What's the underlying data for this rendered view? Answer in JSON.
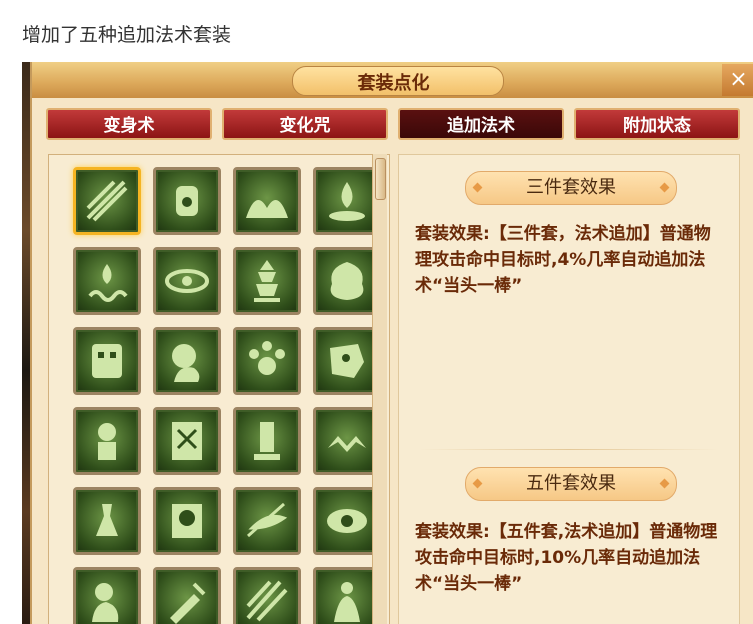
{
  "caption": "增加了五种追加法术套装",
  "window": {
    "title": "套装点化",
    "close_glyph": "×"
  },
  "tabs": [
    {
      "label": "变身术",
      "active": false
    },
    {
      "label": "变化咒",
      "active": false
    },
    {
      "label": "追加法术",
      "active": true
    },
    {
      "label": "附加状态",
      "active": false
    }
  ],
  "icons": [
    "wind-slash-icon",
    "fist-icon",
    "waves-icon",
    "flame-altar-icon",
    "fire-swirl-icon",
    "eye-icon",
    "pagoda-icon",
    "tree-spirit-icon",
    "demon-mask-icon",
    "female-silhouette-icon",
    "paw-icon",
    "beast-head-icon",
    "voodoo-doll-icon",
    "talisman-icon",
    "pillar-icon",
    "chevron-waves-icon",
    "potion-icon",
    "skull-banner-icon",
    "claw-eye-icon",
    "dragon-eye-icon",
    "child-silhouette-icon",
    "broken-sword-icon",
    "slash-lines-icon",
    "dancer-icon"
  ],
  "selected_icon": 0,
  "effects": [
    {
      "title": "三件套效果",
      "desc": "套装效果:【三件套，法术追加】普通物理攻击命中目标时,4%几率自动追加法术“当头一棒”"
    },
    {
      "title": "五件套效果",
      "desc": "套装效果:【五件套,法术追加】普通物理攻击命中目标时,10%几率自动追加法术“当头一棒”"
    }
  ],
  "colors": {
    "tab_red": "#8c1414",
    "tab_active": "#3a0808",
    "text_brown": "#6a2a08",
    "icon_green": "#2f4e1a",
    "select_gold": "#f5b422"
  }
}
